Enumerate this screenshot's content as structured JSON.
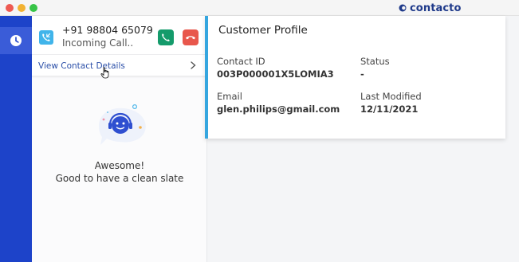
{
  "titlebar": {
    "brand_name": "contacto"
  },
  "rail": {
    "items": [
      {
        "icon": "clock-icon",
        "active": true
      }
    ]
  },
  "call": {
    "number": "+91 98804 65079",
    "status": "Incoming Call..",
    "view_contact_label": "View Contact Details"
  },
  "empty_state": {
    "title": "Awesome!",
    "subtitle": "Good to have a clean slate"
  },
  "profile": {
    "title": "Customer Profile",
    "fields": [
      {
        "label": "Contact ID",
        "value": "003P000001X5LOMIA3"
      },
      {
        "label": "Status",
        "value": "-"
      },
      {
        "label": "Email",
        "value": "glen.philips@gmail.com"
      },
      {
        "label": "Last Modified",
        "value": "12/11/2021"
      }
    ]
  },
  "colors": {
    "rail": "#1d43c9",
    "rail_active": "#3a5cd8",
    "accept": "#149b6b",
    "decline": "#e8574c",
    "accent": "#36a6df",
    "link": "#2b4fa8",
    "brand": "#1f3a8a"
  }
}
